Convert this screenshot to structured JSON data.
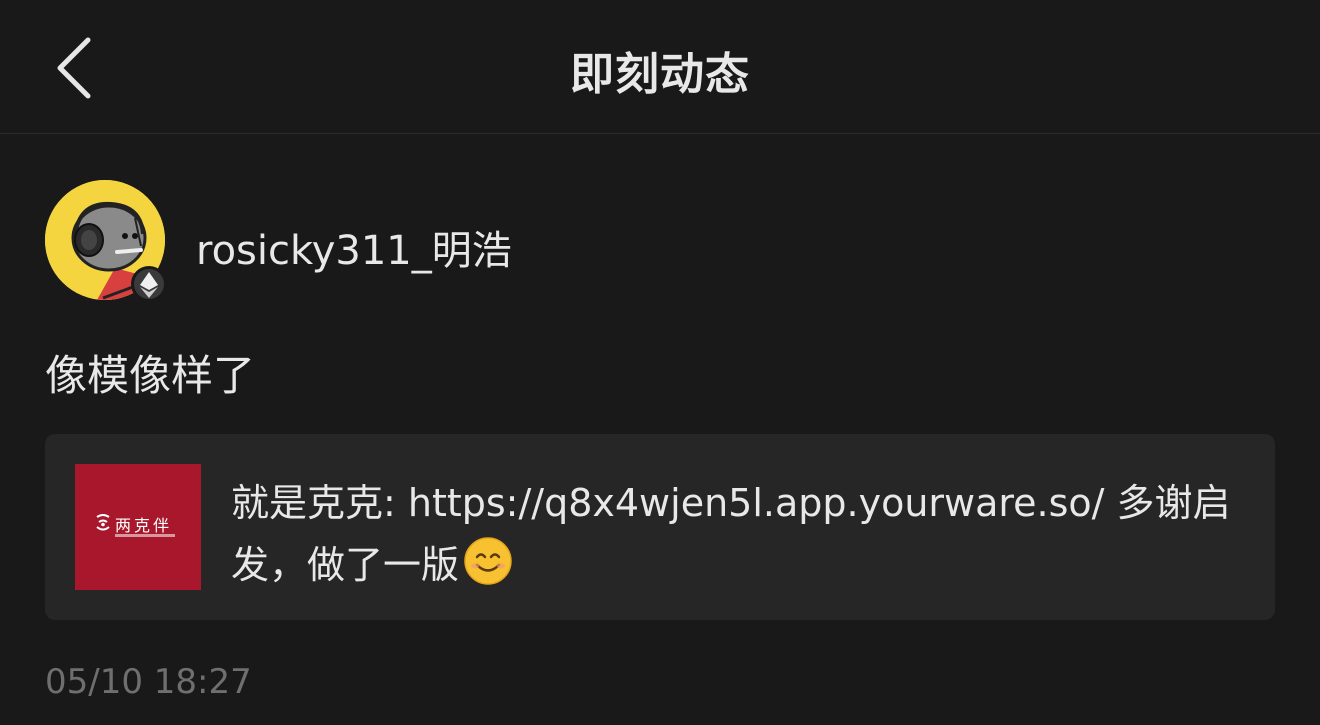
{
  "nav": {
    "title": "即刻动态",
    "back_icon": "chevron-left-icon"
  },
  "author": {
    "username": "rosicky311_明浩",
    "badge_icon": "ethereum-icon"
  },
  "post": {
    "text": "像模像样了"
  },
  "share_card": {
    "thumbnail_brand": "两克伴",
    "text": "就是克克: https://q8x4wjen5l.app.yourware.so/ 多谢启发，做了一版",
    "emoji": "smiling-face-icon"
  },
  "timestamp": "05/10 18:27",
  "colors": {
    "background": "#191919",
    "card": "#262626",
    "thumbnail": "#a8172c",
    "avatar": "#f5d53f",
    "muted_text": "#6f6f6f"
  }
}
